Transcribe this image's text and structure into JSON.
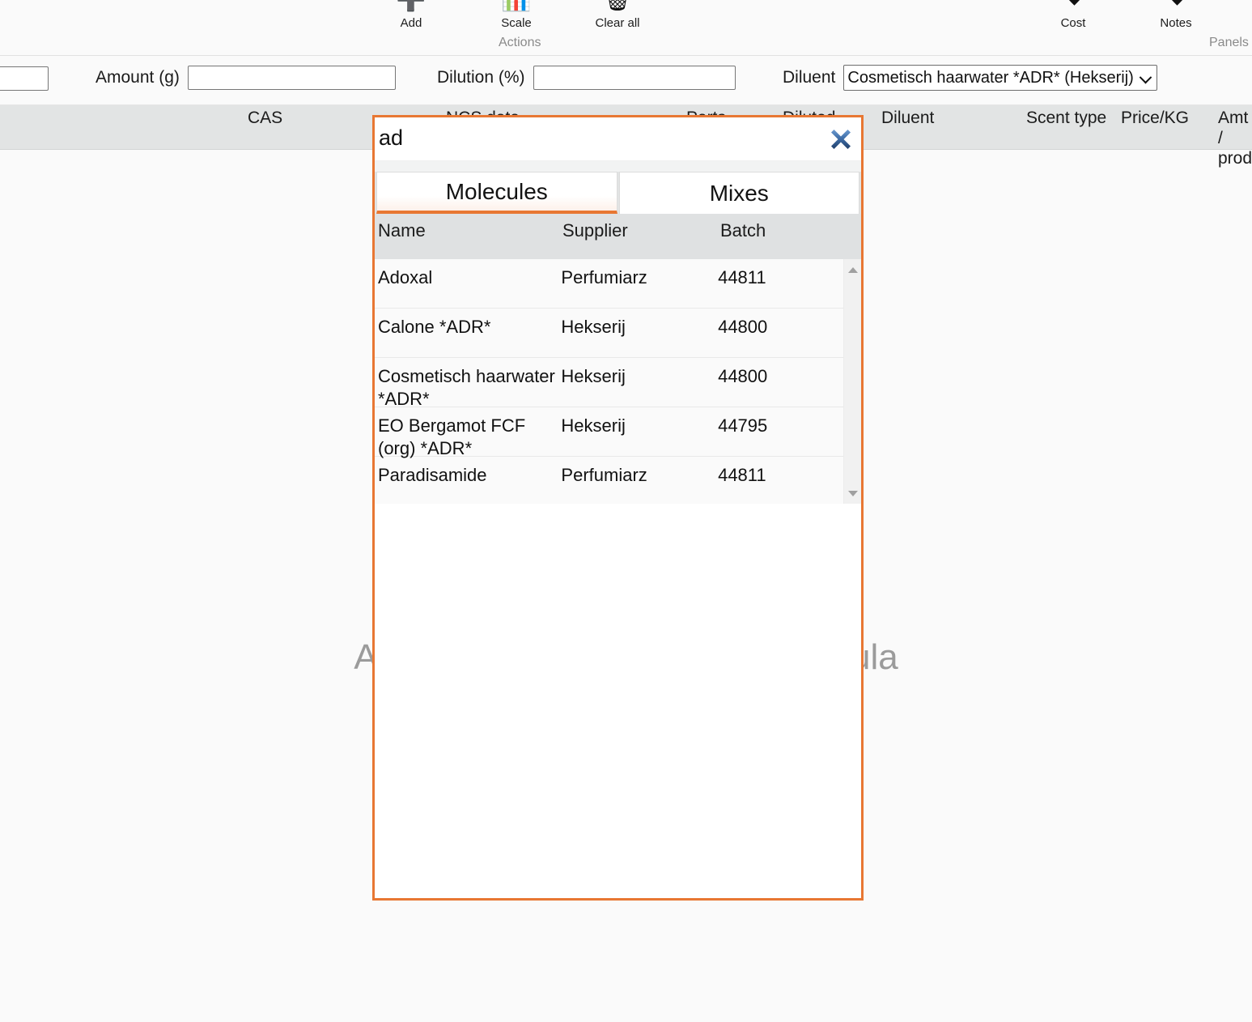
{
  "ribbon": {
    "actions": {
      "caption": "Actions",
      "buttons": [
        {
          "label": "Add",
          "icon": "plus-icon"
        },
        {
          "label": "Scale",
          "icon": "scale-icon"
        },
        {
          "label": "Clear all",
          "icon": "clear-all-icon"
        }
      ]
    },
    "panels": {
      "caption": "Panels",
      "buttons": [
        {
          "label": "Cost",
          "icon": "chevron-down-icon"
        },
        {
          "label": "Notes",
          "icon": "chevron-down-icon"
        }
      ]
    }
  },
  "fields": {
    "left_box_value": "",
    "amount": {
      "label": "Amount (g)",
      "value": "",
      "placeholder": ""
    },
    "dilution": {
      "label": "Dilution (%)",
      "value": "",
      "placeholder": ""
    },
    "diluent": {
      "label": "Diluent",
      "selected": "Cosmetisch haarwater *ADR* (Hekserij)",
      "options": [
        "Cosmetisch haarwater *ADR* (Hekserij)"
      ]
    }
  },
  "grid": {
    "columns": [
      "CAS",
      "NCS data",
      "Parts",
      "Diluted",
      "Diluent",
      "Scent type",
      "Price/KG",
      "Amt /\nprod"
    ],
    "empty_state": "Add materials to start your formula"
  },
  "popup": {
    "search": {
      "value": "ad",
      "placeholder": ""
    },
    "close_icon": "close-icon",
    "tabs": [
      {
        "label": "Molecules",
        "active": true
      },
      {
        "label": "Mixes",
        "active": false
      }
    ],
    "list_columns": [
      "Name",
      "Supplier",
      "Batch"
    ],
    "rows": [
      {
        "name": "Adoxal",
        "supplier": "Perfumiarz",
        "batch": "44811"
      },
      {
        "name": "Calone *ADR*",
        "supplier": "Hekserij",
        "batch": "44800"
      },
      {
        "name": "Cosmetisch haarwater *ADR*",
        "supplier": "Hekserij",
        "batch": "44800"
      },
      {
        "name": "EO Bergamot FCF (org) *ADR*",
        "supplier": "Hekserij",
        "batch": "44795"
      },
      {
        "name": "Paradisamide",
        "supplier": "Perfumiarz",
        "batch": "44811"
      }
    ],
    "scrollbar": {
      "up_icon": "scroll-up-arrow-icon",
      "down_icon": "scroll-down-arrow-icon"
    }
  },
  "colors": {
    "accent": "#e87733",
    "close_x": "#3c6ca8",
    "header_bg": "#e2e4e4",
    "page_bg": "#fafafa"
  }
}
